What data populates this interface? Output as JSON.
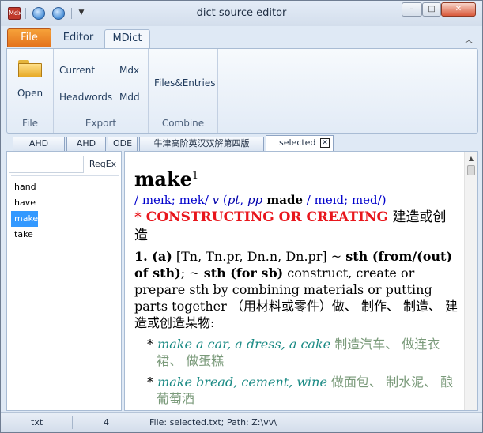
{
  "window": {
    "title": "dict source editor",
    "app_icon_label": "Mdx",
    "minimize": "–",
    "maximize": "□",
    "close": "✕"
  },
  "ribbon_tabs": {
    "file": "File",
    "editor": "Editor",
    "mdict": "MDict"
  },
  "ribbon": {
    "file_group": {
      "open": "Open",
      "label": "File"
    },
    "export_group": {
      "current": "Current",
      "mdx": "Mdx",
      "headwords": "Headwords",
      "mdd": "Mdd",
      "label": "Export"
    },
    "combine_group": {
      "files_entries": "Files&Entries",
      "label": "Combine"
    }
  },
  "doc_tabs": [
    {
      "label": "AHD"
    },
    {
      "label": "AHD"
    },
    {
      "label": "ODE"
    },
    {
      "label": "牛津高阶英汉双解第四版"
    },
    {
      "label": "selected",
      "active": true
    }
  ],
  "search": {
    "placeholder": "",
    "value": "",
    "regex_label": "RegEx"
  },
  "word_list": [
    "hand",
    "have",
    "make",
    "take"
  ],
  "selected_word": "make",
  "entry": {
    "headword": "make",
    "homograph": "1",
    "pron_1": "/ meɪk; mek/ ",
    "pos": "v",
    "forms_open": " (",
    "pt": "pt",
    "comma": ", ",
    "pp": "pp",
    "made": " made",
    "pron_2": " / meɪd; med/)",
    "sense_title": "* CONSTRUCTING OR CREATING",
    "sense_title_cn": " 建造或创造",
    "def_num": "1.",
    "def_a": " (a)",
    "def_pattern": " [Tn, Tn.pr, Dn.n, Dn.pr] ~ ",
    "def_sth_from": "sth (from/(out) of sth)",
    "def_mid": "; ~ ",
    "def_sth_for": "sth (for sb)",
    "def_text": " construct, create or prepare sth by combining materials or putting parts together （用材料或零件）做、 制作、 制造、 建造或创造某物:",
    "examples": [
      {
        "en": "make a car, a dress, a cake",
        "zh": " 制造汽车、 做连衣裙、 做蛋糕"
      },
      {
        "en": "make bread, cement, wine",
        "zh": " 做面包、 制水泥、 酿葡萄酒"
      }
    ]
  },
  "status_bar": {
    "format": "txt",
    "count": "4",
    "file_info": "File: selected.txt;  Path: Z:\\vv\\"
  },
  "colors": {
    "accent_orange": "#e3701b",
    "sense_red": "#e8161c",
    "pron_blue": "#0000cc",
    "example_teal": "#1a8a84",
    "selection_blue": "#3399ff"
  }
}
